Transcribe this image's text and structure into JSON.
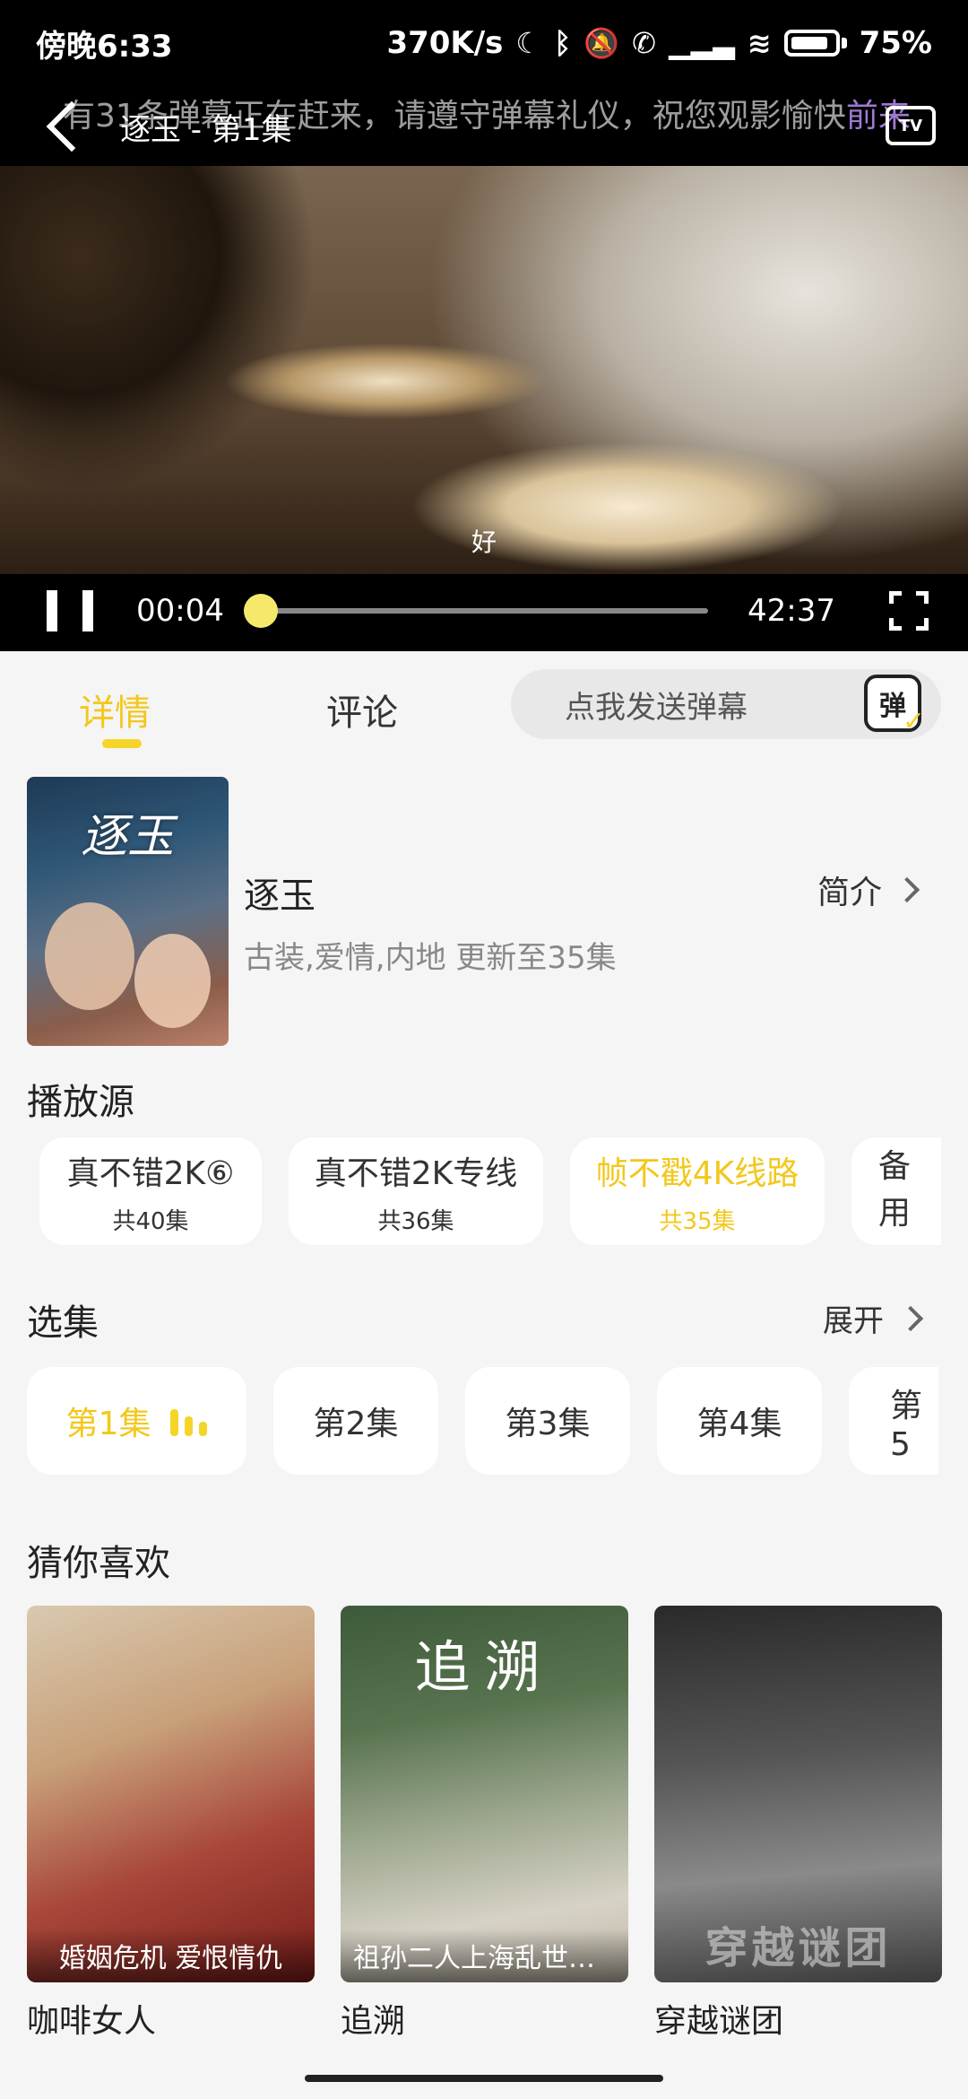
{
  "status_bar": {
    "time": "傍晚6:33",
    "network_speed": "370K/s",
    "battery": "75%"
  },
  "player": {
    "title": "逐玉 - 第1集",
    "danmaku_notice": "有31条弹幕正在赶来，请遵守弹幕礼仪，祝您观影愉快",
    "danmaku_notice_tail": "前来",
    "subtitle": "好",
    "current_time": "00:04",
    "total_time": "42:37",
    "progress_fraction": 0.0016,
    "tv_label": "TV"
  },
  "tabs": {
    "details": "详情",
    "comments": "评论",
    "danmaku_placeholder": "点我发送弹幕",
    "danmaku_button": "弹"
  },
  "drama": {
    "poster_title": "逐玉",
    "title": "逐玉",
    "meta": "古装,爱情,内地 更新至35集",
    "intro_label": "简介"
  },
  "sources": {
    "title": "播放源",
    "items": [
      {
        "name": "真不错2K⑥",
        "count": "共40集"
      },
      {
        "name": "真不错2K专线",
        "count": "共36集"
      },
      {
        "name": "帧不戳4K线路",
        "count": "共35集",
        "active": true
      },
      {
        "name": "备用",
        "count": ""
      }
    ]
  },
  "episodes": {
    "title": "选集",
    "expand_label": "展开",
    "items": [
      "第1集",
      "第2集",
      "第3集",
      "第4集",
      "第5"
    ]
  },
  "recommend": {
    "title": "猜你喜欢",
    "items": [
      {
        "title": "咖啡女人",
        "caption": "婚姻危机 爱恨情仇"
      },
      {
        "title": "追溯",
        "caption": "祖孙二人上海乱世…",
        "poster_title": "追溯"
      },
      {
        "title": "穿越谜团",
        "caption": "",
        "poster_title": "穿越谜团"
      }
    ]
  },
  "colors": {
    "accent": "#f2c81c",
    "background": "#f5f5f5"
  }
}
